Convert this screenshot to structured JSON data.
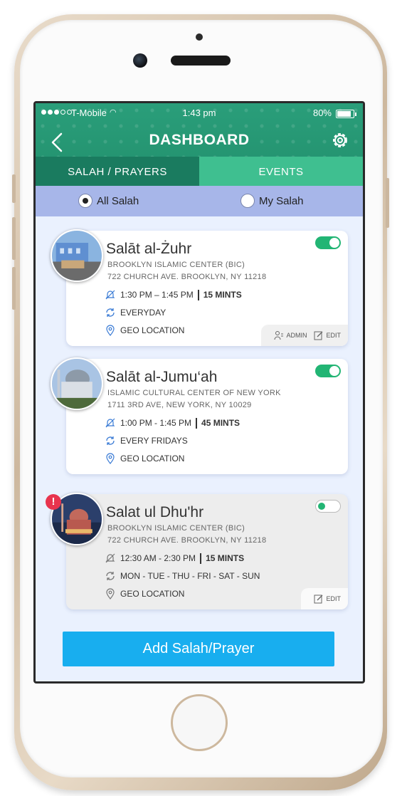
{
  "status_bar": {
    "carrier": "T-Mobile",
    "time": "1:43 pm",
    "battery": "80%"
  },
  "header": {
    "title": "DASHBOARD"
  },
  "tabs": [
    {
      "label": "SALAH / PRAYERS",
      "active": true
    },
    {
      "label": "EVENTS",
      "active": false
    }
  ],
  "filter": {
    "all_label": "All Salah",
    "my_label": "My Salah",
    "selected": "All Salah"
  },
  "cards": [
    {
      "name": "Salāt al-Żuhr",
      "org": "BROOKLYN ISLAMIC CENTER (BIC)",
      "address": "722 CHURCH AVE. BROOKLYN, NY 11218",
      "time": "1:30 PM – 1:45 PM",
      "duration": "15 MINTS",
      "repeat": "EVERYDAY",
      "location": "GEO LOCATION",
      "enabled": true,
      "admin_label": "ADMIN",
      "edit_label": "EDIT"
    },
    {
      "name": "Salāt al-Jumu‘ah",
      "org": "ISLAMIC CULTURAL CENTER OF NEW YORK",
      "address": "1711 3RD AVE, NEW YORK, NY 10029",
      "time": "1:00 PM - 1:45 PM",
      "duration": "45 MINTS",
      "repeat": "EVERY FRIDAYS",
      "location": "GEO LOCATION",
      "enabled": true
    },
    {
      "name": "Salat ul Dhu'hr",
      "org": "BROOKLYN ISLAMIC CENTER (BIC)",
      "address": "722 CHURCH AVE. BROOKLYN, NY 11218",
      "time": "12:30 AM - 2:30 PM",
      "duration": "15 MINTS",
      "repeat": "MON - TUE - THU - FRI - SAT - SUN",
      "location": "GEO LOCATION",
      "enabled": false,
      "alert": "!",
      "edit_label": "EDIT"
    }
  ],
  "add_button": "Add Salah/Prayer",
  "colors": {
    "header": "#22906d",
    "active_tab": "#1a7b5f",
    "inactive_tab": "#3fbf90",
    "filter_bar": "#a7b6e9",
    "button": "#18aeef",
    "toggle_on": "#22b574"
  }
}
